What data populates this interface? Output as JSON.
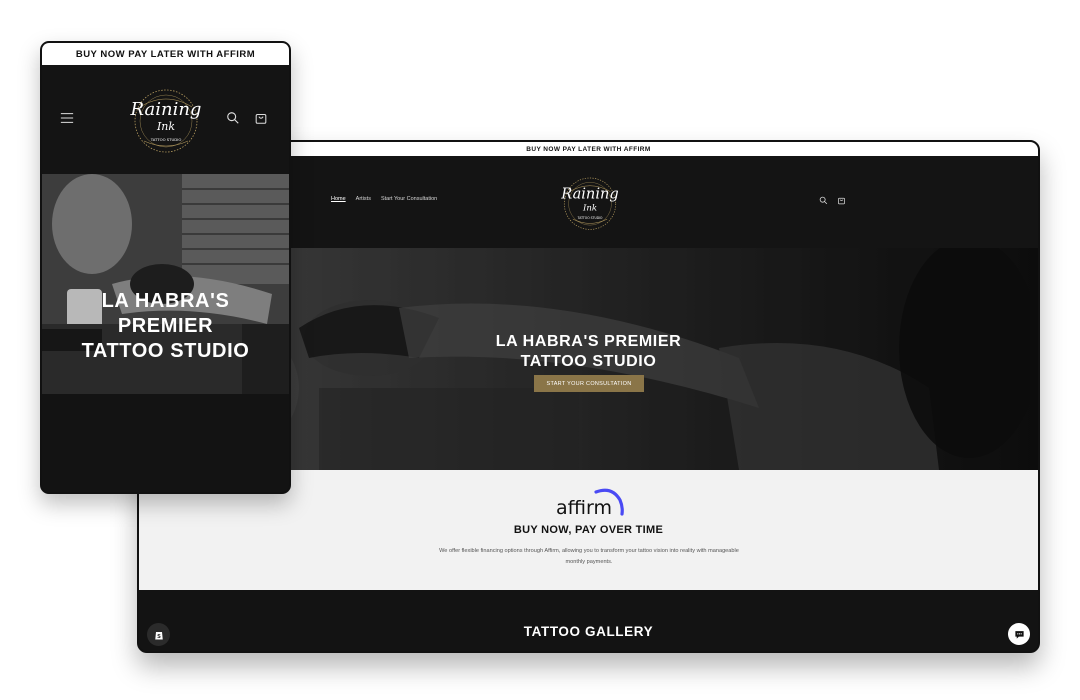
{
  "announcement": "BUY NOW PAY LATER WITH AFFIRM",
  "nav": {
    "items": [
      {
        "label": "Home"
      },
      {
        "label": "Artists"
      },
      {
        "label": "Start Your Consultation"
      }
    ]
  },
  "brand": {
    "line1": "Raining",
    "line2": "Ink",
    "tag": "TATTOO STUDIO",
    "gold": "#b39a5e"
  },
  "hero": {
    "title_line1": "LA HABRA'S PREMIER",
    "title_line2": "TATTOO STUDIO",
    "cta": "START YOUR CONSULTATION",
    "cta_color": "#8a7548"
  },
  "mobile_hero": {
    "line1": "LA HABRA'S",
    "line2": "PREMIER",
    "line3": "TATTOO STUDIO"
  },
  "affirm": {
    "logo": "affirm",
    "title": "BUY NOW, PAY OVER TIME",
    "description": "We offer flexible financing options through Affirm, allowing you to transform your tattoo vision into reality with manageable monthly payments.",
    "accent": "#4a4af4"
  },
  "gallery": {
    "title": "TATTOO GALLERY"
  },
  "icons": {
    "search": "search-icon",
    "cart": "cart-icon",
    "menu": "hamburger-menu-icon",
    "shop": "shopify-icon",
    "chat": "chat-icon"
  }
}
